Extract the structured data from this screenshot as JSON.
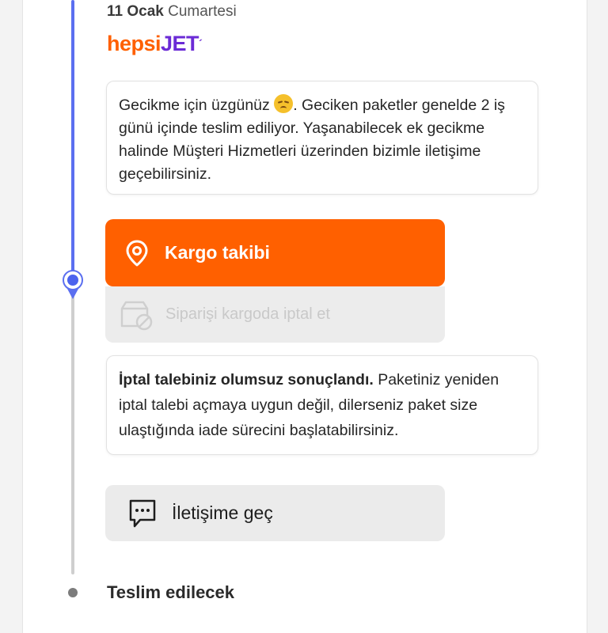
{
  "timeline": {
    "date_bold": "11 Ocak",
    "date_day": "Cumartesi",
    "carrier": {
      "part1": "hepsi",
      "part2": "JET",
      "part3": "´"
    },
    "delay_message": {
      "before_emoji": "Gecikme için üzgünüz",
      "emoji_icon": "sad-face-emoji",
      "after_emoji": ". Geciken paketler genelde 2 iş günü içinde teslim ediliyor. Yaşanabilecek ek gecikme halinde Müşteri Hizmetleri üzerinden bizimle iletişime geçebilirsiniz."
    },
    "track_button": {
      "label": "Kargo takibi",
      "icon": "location-pin-icon"
    },
    "cancel_button": {
      "label": "Siparişi kargoda iptal et",
      "icon": "box-cancel-icon"
    },
    "cancel_result": {
      "bold": "İptal talebiniz olumsuz sonuçlandı.",
      "text": " Paketiniz yeniden iptal talebi açmaya uygun değil, dilerseniz paket size ulaştığında iade sürecini başlatabilirsiniz."
    },
    "contact_button": {
      "label": "İletişime geç",
      "icon": "chat-bubble-icon"
    },
    "next_step": "Teslim edilecek"
  },
  "colors": {
    "accent_orange": "#ff6000",
    "brand_purple": "#6b2bd6",
    "timeline_blue": "#5b6ff0",
    "timeline_grey": "#cfcfcf"
  }
}
